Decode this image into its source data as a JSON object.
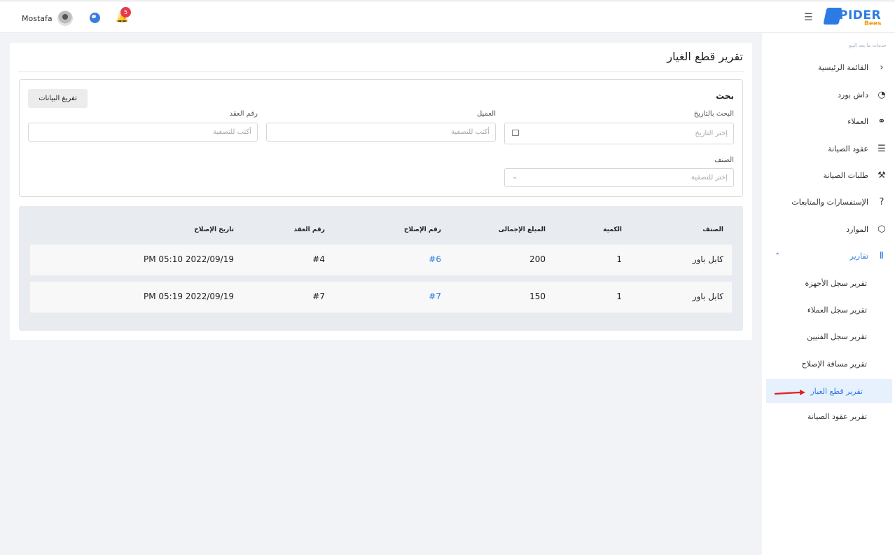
{
  "topbar": {
    "username": "Mostafa",
    "notification_count": "5",
    "brand_name": "PIDER",
    "brand_sub": "Bees"
  },
  "sidebar": {
    "caption": "خدمات ما بعد البيع",
    "items": [
      {
        "label": "القائمة الرئيسية",
        "icon": "chevron-left-icon"
      },
      {
        "label": "داش بورد",
        "icon": "gauge-icon"
      },
      {
        "label": "العملاء",
        "icon": "users-icon"
      },
      {
        "label": "عقود الصيانة",
        "icon": "list-icon"
      },
      {
        "label": "طلبات الصيانة",
        "icon": "tools-icon"
      },
      {
        "label": "الإستفسارات والمتابعات",
        "icon": "question-icon"
      },
      {
        "label": "الموارد",
        "icon": "nodes-icon"
      },
      {
        "label": "تقارير",
        "icon": "chart-icon"
      }
    ],
    "reports_submenu": [
      "تقرير سجل الأجهزة",
      "تقرير سجل العملاء",
      "تقرير سجل الفنيين",
      "تقرير مسافة الإصلاح",
      "تقرير قطع الغيار",
      "تقرير عقود الصيانة"
    ]
  },
  "page": {
    "title": "تقرير قطع الغيار"
  },
  "search": {
    "title": "بحث",
    "clear_label": "تفريغ البيانات",
    "date_label": "البحث بالتاريخ",
    "date_placeholder": "إختر التاريخ",
    "client_label": "العميل",
    "client_placeholder": "أكتب للتصفية",
    "contract_label": "رقم العقد",
    "contract_placeholder": "أكتب للتصفية",
    "item_label": "الصنف",
    "item_placeholder": "إختر للتصفية"
  },
  "table": {
    "headers": [
      "الصنف",
      "الكمية",
      "المبلغ الإجمالى",
      "رقم الإصلاح",
      "رقم العقد",
      "تاريخ الإصلاح"
    ],
    "rows": [
      {
        "item": "كابل  باور",
        "qty": "1",
        "total": "200",
        "repair": "#6",
        "contract": "#4",
        "date": "2022/09/19 05:10 PM"
      },
      {
        "item": "كابل باور",
        "qty": "1",
        "total": "150",
        "repair": "#7",
        "contract": "#7",
        "date": "2022/09/19 05:19 PM"
      }
    ]
  }
}
